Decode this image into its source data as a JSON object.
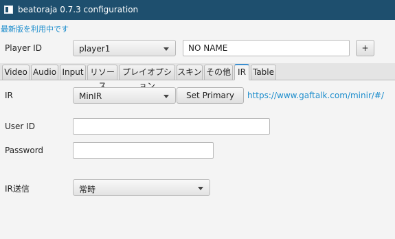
{
  "window": {
    "title": "beatoraja 0.7.3 configuration",
    "icon": "app-window-icon"
  },
  "update_notice": "最新版を利用中です",
  "player": {
    "label": "Player ID",
    "selected": "player1",
    "name_value": "NO NAME",
    "add_label": "+"
  },
  "tabs": [
    {
      "label": "Video",
      "active": false
    },
    {
      "label": "Audio",
      "active": false
    },
    {
      "label": "Input",
      "active": false
    },
    {
      "label": "リソース",
      "active": false
    },
    {
      "label": "プレイオプション",
      "active": false
    },
    {
      "label": "スキン",
      "active": false
    },
    {
      "label": "その他",
      "active": false
    },
    {
      "label": "IR",
      "active": true
    },
    {
      "label": "Table",
      "active": false
    }
  ],
  "ir": {
    "label": "IR",
    "selected": "MinIR",
    "set_primary_label": "Set Primary",
    "url": "https://www.gaftalk.com/minir/#/",
    "user_id_label": "User ID",
    "user_id_value": "",
    "password_label": "Password",
    "password_value": "",
    "send_label": "IR送信",
    "send_selected": "常時"
  },
  "colors": {
    "titlebar": "#1e4f6e",
    "link": "#1a8ccc",
    "tab_accent": "#3c8fd0",
    "background": "#f4f4f4"
  }
}
